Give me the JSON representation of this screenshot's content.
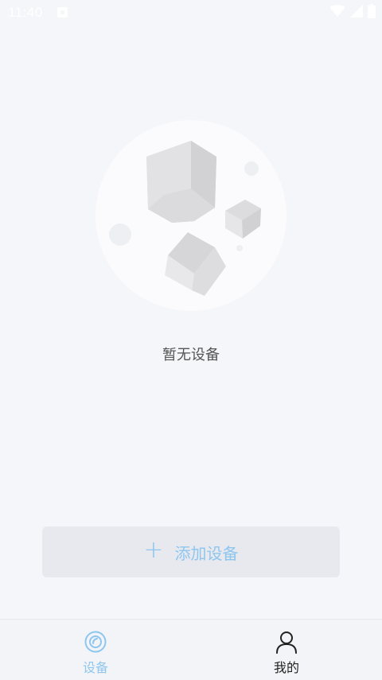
{
  "status_bar": {
    "time": "11:40",
    "icons": [
      "notification-icon",
      "wifi-icon",
      "signal-icon",
      "battery-icon"
    ]
  },
  "empty_state": {
    "message": "暂无设备",
    "illustration": "empty-boxes-illustration"
  },
  "add_button": {
    "icon": "+",
    "label": "添加设备"
  },
  "bottom_nav": {
    "items": [
      {
        "label": "设备",
        "icon": "device-icon",
        "active": true
      },
      {
        "label": "我的",
        "icon": "person-icon",
        "active": false
      }
    ]
  },
  "colors": {
    "accent": "#8ec6ef",
    "background": "#f5f6f9"
  }
}
